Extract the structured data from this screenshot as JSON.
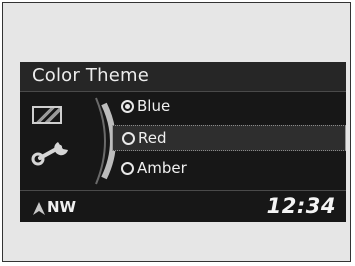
{
  "screen": {
    "title": "Color Theme"
  },
  "options": [
    {
      "label": "Blue",
      "checked": true
    },
    {
      "label": "Red",
      "checked": false,
      "highlighted": true
    },
    {
      "label": "Amber",
      "checked": false
    }
  ],
  "status": {
    "heading": "NW",
    "clock": "12:34"
  },
  "icons": {
    "gauge": "gauge-icon",
    "wrench": "wrench-icon",
    "navigation": "navigation-arrow-icon"
  }
}
